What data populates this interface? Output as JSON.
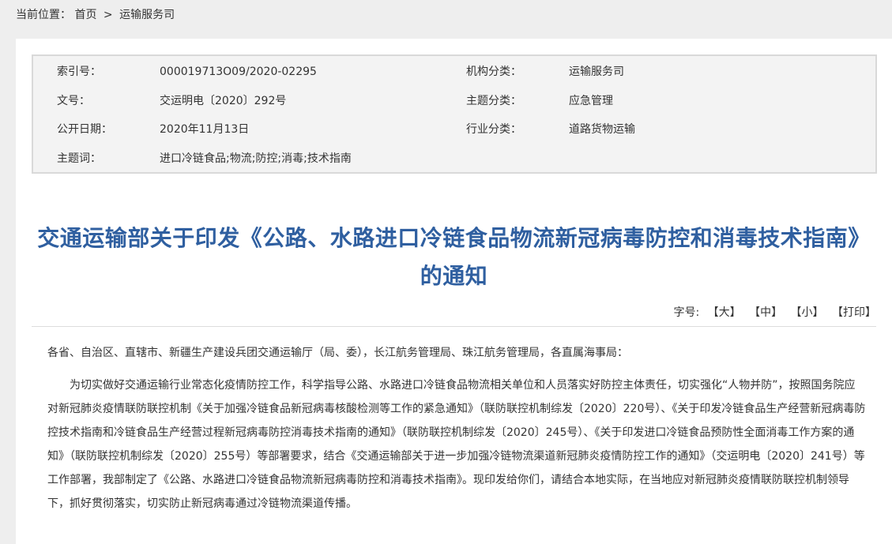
{
  "breadcrumb": {
    "prefix": "当前位置：",
    "home": "首页",
    "separator": ">",
    "current": "运输服务司"
  },
  "meta": {
    "index_label": "索引号：",
    "index_value": "000019713O09/2020-02295",
    "org_label": "机构分类：",
    "org_value": "运输服务司",
    "docno_label": "文号：",
    "docno_value": "交运明电〔2020〕292号",
    "topic_label": "主题分类：",
    "topic_value": "应急管理",
    "date_label": "公开日期：",
    "date_value": "2020年11月13日",
    "industry_label": "行业分类：",
    "industry_value": "道路货物运输",
    "keywords_label": "主题词：",
    "keywords_value": "进口冷链食品;物流;防控;消毒;技术指南"
  },
  "article": {
    "title": "交通运输部关于印发《公路、水路进口冷链食品物流新冠病毒防控和消毒技术指南》的通知",
    "fontsize_label": "字号:",
    "fontsize_large": "【大】",
    "fontsize_medium": "【中】",
    "fontsize_small": "【小】",
    "print_label": "【打印】",
    "salutation": "各省、自治区、直辖市、新疆生产建设兵团交通运输厅（局、委），长江航务管理局、珠江航务管理局，各直属海事局：",
    "paragraph1": "为切实做好交通运输行业常态化疫情防控工作，科学指导公路、水路进口冷链食品物流相关单位和人员落实好防控主体责任，切实强化“人物并防”，按照国务院应对新冠肺炎疫情联防联控机制《关于加强冷链食品新冠病毒核酸检测等工作的紧急通知》（联防联控机制综发〔2020〕220号）、《关于印发冷链食品生产经营新冠病毒防控技术指南和冷链食品生产经营过程新冠病毒防控消毒技术指南的通知》（联防联控机制综发〔2020〕245号）、《关于印发进口冷链食品预防性全面消毒工作方案的通知》（联防联控机制综发〔2020〕255号）等部署要求，结合《交通运输部关于进一步加强冷链物流渠道新冠肺炎疫情防控工作的通知》（交运明电〔2020〕241号）等工作部署，我部制定了《公路、水路进口冷链食品物流新冠病毒防控和消毒技术指南》。现印发给你们，请结合本地实际，在当地应对新冠肺炎疫情联防联控机制领导下，抓好贯彻落实，切实防止新冠病毒通过冷链物流渠道传播。"
  }
}
